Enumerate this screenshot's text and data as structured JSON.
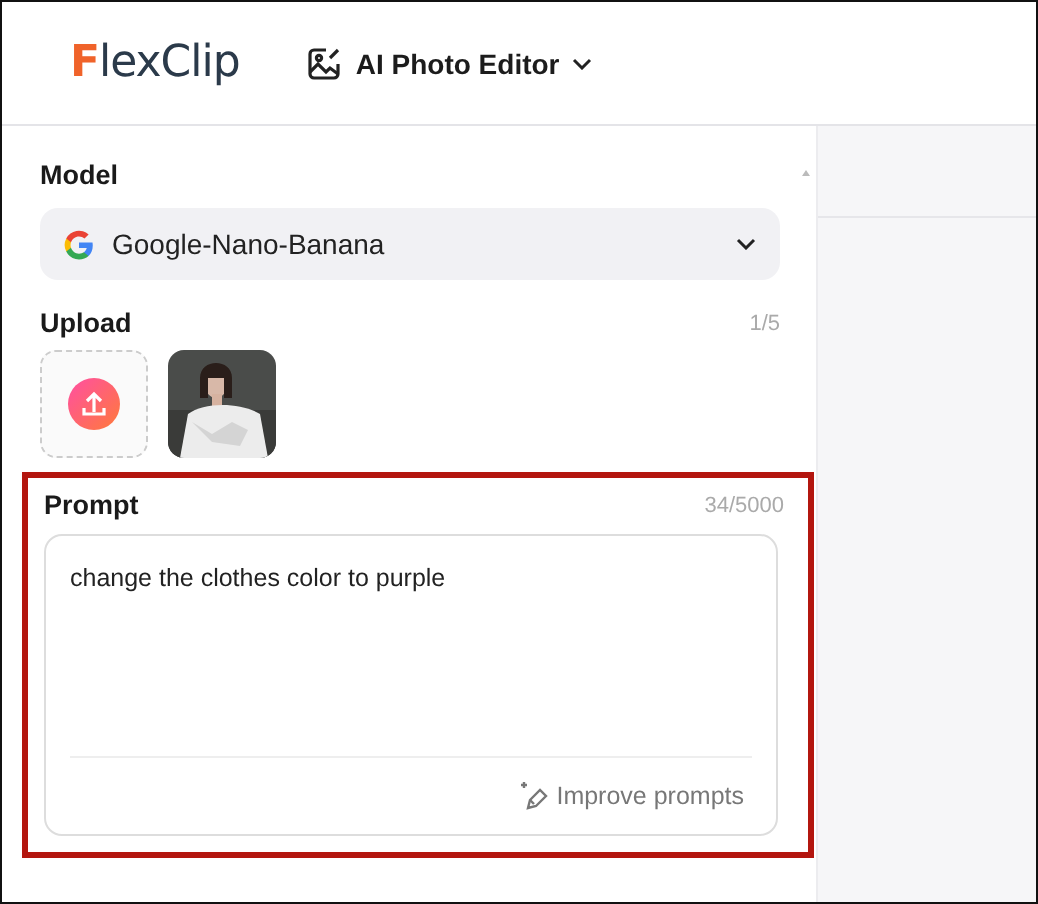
{
  "header": {
    "logo": {
      "accent": "F",
      "rest": "lexClip"
    },
    "tool_menu": {
      "label": "AI Photo Editor"
    }
  },
  "model": {
    "label": "Model",
    "value": "Google-Nano-Banana"
  },
  "upload": {
    "label": "Upload",
    "count": "1/5"
  },
  "prompt": {
    "label": "Prompt",
    "count": "34/5000",
    "value": "change the clothes color to purple",
    "improve": "Improve prompts",
    "highlighted": true
  }
}
